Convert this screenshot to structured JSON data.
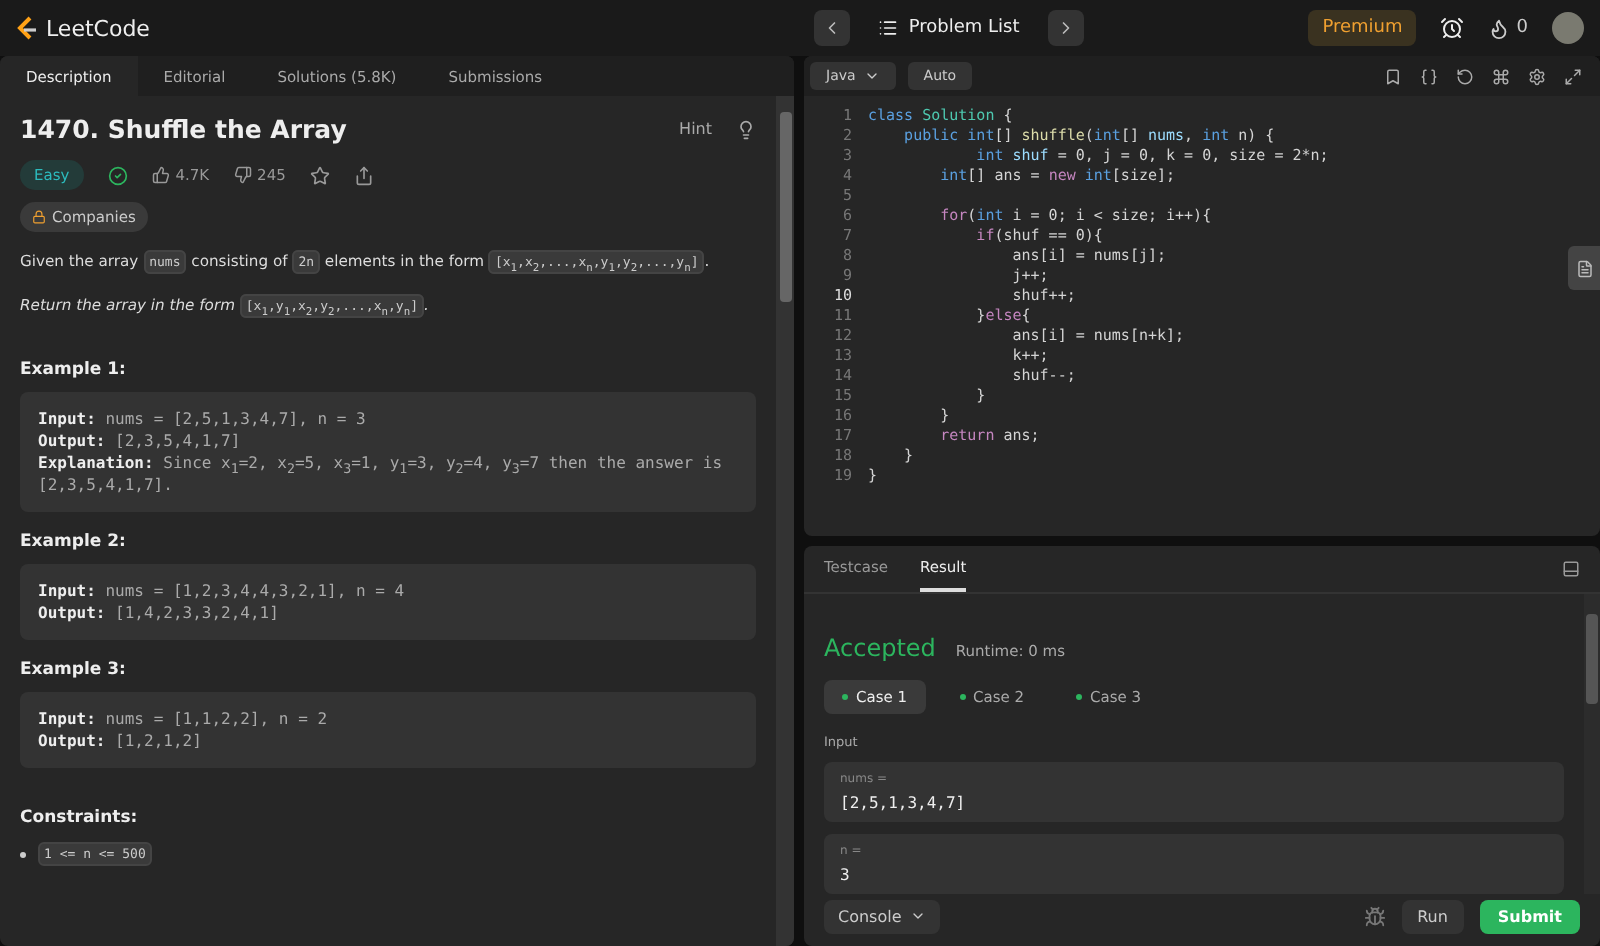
{
  "header": {
    "logo": "LeetCode",
    "problem_list": "Problem List",
    "premium": "Premium",
    "streak": "0"
  },
  "left_tabs": [
    {
      "label": "Description",
      "selected": true
    },
    {
      "label": "Editorial",
      "selected": false
    },
    {
      "label": "Solutions (5.8K)",
      "selected": false
    },
    {
      "label": "Submissions",
      "selected": false
    }
  ],
  "problem": {
    "title": "1470. Shuffle the Array",
    "hint": "Hint",
    "difficulty": "Easy",
    "solved": true,
    "likes": "4.7K",
    "dislikes": "245",
    "companies": "Companies",
    "paragraphs": [
      {
        "italic": false,
        "segments": [
          {
            "kind": "text",
            "text": "Given the array "
          },
          {
            "kind": "code",
            "text": "nums"
          },
          {
            "kind": "text",
            "text": " consisting of "
          },
          {
            "kind": "code",
            "text": "2n"
          },
          {
            "kind": "text",
            "text": " elements in the form "
          },
          {
            "kind": "code",
            "text": "[x$_{1}$,x$_{2}$,...,x$_{n}$,y$_{1}$,y$_{2}$,...,y$_{n}$]"
          },
          {
            "kind": "text",
            "text": "."
          }
        ]
      },
      {
        "italic": true,
        "segments": [
          {
            "kind": "text",
            "text": "Return the array in the form "
          },
          {
            "kind": "code",
            "text": "[x$_{1}$,y$_{1}$,x$_{2}$,y$_{2}$,...,x$_{n}$,y$_{n}$]"
          },
          {
            "kind": "text",
            "text": "."
          }
        ]
      }
    ],
    "examples": [
      {
        "title": "Example 1:",
        "lines": [
          {
            "label": "Input:",
            "value": "nums = [2,5,1,3,4,7], n = 3"
          },
          {
            "label": "Output:",
            "value": "[2,3,5,4,1,7]"
          },
          {
            "label": "Explanation:",
            "value": "Since x$_{1}$=2, x$_{2}$=5, x$_{3}$=1, y$_{1}$=3, y$_{2}$=4, y$_{3}$=7 then the answer is [2,3,5,4,1,7]."
          }
        ]
      },
      {
        "title": "Example 2:",
        "lines": [
          {
            "label": "Input:",
            "value": "nums = [1,2,3,4,4,3,2,1], n = 4"
          },
          {
            "label": "Output:",
            "value": "[1,4,2,3,3,2,4,1]"
          }
        ]
      },
      {
        "title": "Example 3:",
        "lines": [
          {
            "label": "Input:",
            "value": "nums = [1,1,2,2], n = 2"
          },
          {
            "label": "Output:",
            "value": "[1,2,1,2]"
          }
        ]
      }
    ],
    "constraints_title": "Constraints:",
    "constraints": [
      "1 <= n <= 500"
    ]
  },
  "editor": {
    "language": "Java",
    "mode": "Auto",
    "lines": [
      {
        "number": "1",
        "segments": [
          {
            "kind": "kw",
            "text": "class "
          },
          {
            "kind": "type",
            "text": "Solution"
          },
          {
            "kind": "plain",
            "text": " {"
          }
        ]
      },
      {
        "number": "2",
        "segments": [
          {
            "kind": "kw",
            "text": "    public int"
          },
          {
            "kind": "plain",
            "text": "[] "
          },
          {
            "kind": "fn",
            "text": "shuffle"
          },
          {
            "kind": "plain",
            "text": "("
          },
          {
            "kind": "kw",
            "text": "int"
          },
          {
            "kind": "plain",
            "text": "[] "
          },
          {
            "kind": "var",
            "text": "nums"
          },
          {
            "kind": "plain",
            "text": ", "
          },
          {
            "kind": "kw",
            "text": "int"
          },
          {
            "kind": "plain",
            "text": " n) {"
          }
        ]
      },
      {
        "number": "3",
        "segments": [
          {
            "kind": "kw",
            "text": "            int"
          },
          {
            "kind": "var",
            "text": " shuf"
          },
          {
            "kind": "plain",
            "text": " = 0, j = 0, k = 0, size = 2*n;"
          }
        ]
      },
      {
        "number": "4",
        "segments": [
          {
            "kind": "kw",
            "text": "        int"
          },
          {
            "kind": "plain",
            "text": "[] ans = "
          },
          {
            "kind": "ctl",
            "text": "new "
          },
          {
            "kind": "kw",
            "text": "int"
          },
          {
            "kind": "plain",
            "text": "[size];"
          }
        ]
      },
      {
        "number": "5"
      },
      {
        "number": "6",
        "segments": [
          {
            "kind": "ctl",
            "text": "        for"
          },
          {
            "kind": "plain",
            "text": "("
          },
          {
            "kind": "kw",
            "text": "int"
          },
          {
            "kind": "plain",
            "text": " i = 0; i < size; i++){"
          }
        ]
      },
      {
        "number": "7",
        "segments": [
          {
            "kind": "ctl",
            "text": "            if"
          },
          {
            "kind": "plain",
            "text": "(shuf == 0){"
          }
        ]
      },
      {
        "number": "8",
        "segments": [
          {
            "kind": "plain",
            "text": "                ans[i] = nums[j];"
          }
        ]
      },
      {
        "number": "9",
        "segments": [
          {
            "kind": "plain",
            "text": "                j++;"
          }
        ]
      },
      {
        "number": "10",
        "active": true,
        "segments": [
          {
            "kind": "plain",
            "text": "                shuf++;"
          }
        ]
      },
      {
        "number": "11",
        "segments": [
          {
            "kind": "plain",
            "text": "            }"
          },
          {
            "kind": "ctl",
            "text": "else"
          },
          {
            "kind": "plain",
            "text": "{"
          }
        ]
      },
      {
        "number": "12",
        "segments": [
          {
            "kind": "plain",
            "text": "                ans[i] = nums[n+k];"
          }
        ]
      },
      {
        "number": "13",
        "segments": [
          {
            "kind": "plain",
            "text": "                k++;"
          }
        ]
      },
      {
        "number": "14",
        "segments": [
          {
            "kind": "plain",
            "text": "                shuf--;"
          }
        ]
      },
      {
        "number": "15",
        "segments": [
          {
            "kind": "plain",
            "text": "            }"
          }
        ]
      },
      {
        "number": "16",
        "segments": [
          {
            "kind": "plain",
            "text": "        }"
          }
        ]
      },
      {
        "number": "17",
        "segments": [
          {
            "kind": "ctl",
            "text": "        return"
          },
          {
            "kind": "plain",
            "text": " ans;"
          }
        ]
      },
      {
        "number": "18",
        "segments": [
          {
            "kind": "plain",
            "text": "    }"
          }
        ]
      },
      {
        "number": "19",
        "segments": [
          {
            "kind": "plain",
            "text": "}"
          }
        ]
      }
    ]
  },
  "bottom_tabs": [
    {
      "label": "Testcase",
      "selected": false
    },
    {
      "label": "Result",
      "selected": true
    }
  ],
  "result": {
    "status": "Accepted",
    "runtime": "Runtime: 0 ms",
    "cases": [
      {
        "label": "Case 1",
        "selected": true
      },
      {
        "label": "Case 2",
        "selected": false
      },
      {
        "label": "Case 3",
        "selected": false
      }
    ],
    "input_label": "Input",
    "inputs": [
      {
        "name": "nums =",
        "value": "[2,5,1,3,4,7]"
      },
      {
        "name": "n =",
        "value": "3"
      }
    ]
  },
  "footer": {
    "console": "Console",
    "run": "Run",
    "submit": "Submit"
  }
}
